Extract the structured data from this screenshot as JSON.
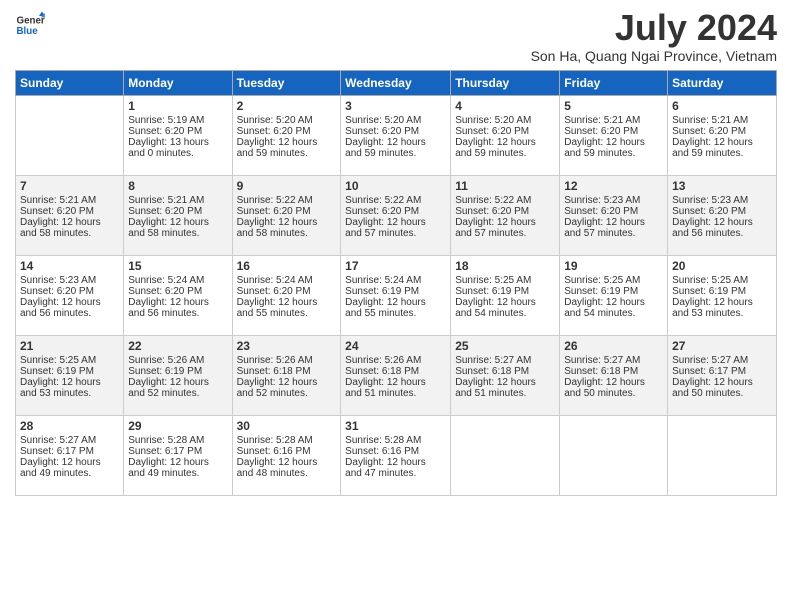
{
  "logo": {
    "line1": "General",
    "line2": "Blue"
  },
  "title": "July 2024",
  "subtitle": "Son Ha, Quang Ngai Province, Vietnam",
  "days_of_week": [
    "Sunday",
    "Monday",
    "Tuesday",
    "Wednesday",
    "Thursday",
    "Friday",
    "Saturday"
  ],
  "weeks": [
    [
      {
        "day": "",
        "info": ""
      },
      {
        "day": "1",
        "info": "Sunrise: 5:19 AM\nSunset: 6:20 PM\nDaylight: 13 hours\nand 0 minutes."
      },
      {
        "day": "2",
        "info": "Sunrise: 5:20 AM\nSunset: 6:20 PM\nDaylight: 12 hours\nand 59 minutes."
      },
      {
        "day": "3",
        "info": "Sunrise: 5:20 AM\nSunset: 6:20 PM\nDaylight: 12 hours\nand 59 minutes."
      },
      {
        "day": "4",
        "info": "Sunrise: 5:20 AM\nSunset: 6:20 PM\nDaylight: 12 hours\nand 59 minutes."
      },
      {
        "day": "5",
        "info": "Sunrise: 5:21 AM\nSunset: 6:20 PM\nDaylight: 12 hours\nand 59 minutes."
      },
      {
        "day": "6",
        "info": "Sunrise: 5:21 AM\nSunset: 6:20 PM\nDaylight: 12 hours\nand 59 minutes."
      }
    ],
    [
      {
        "day": "7",
        "info": "Sunrise: 5:21 AM\nSunset: 6:20 PM\nDaylight: 12 hours\nand 58 minutes."
      },
      {
        "day": "8",
        "info": "Sunrise: 5:21 AM\nSunset: 6:20 PM\nDaylight: 12 hours\nand 58 minutes."
      },
      {
        "day": "9",
        "info": "Sunrise: 5:22 AM\nSunset: 6:20 PM\nDaylight: 12 hours\nand 58 minutes."
      },
      {
        "day": "10",
        "info": "Sunrise: 5:22 AM\nSunset: 6:20 PM\nDaylight: 12 hours\nand 57 minutes."
      },
      {
        "day": "11",
        "info": "Sunrise: 5:22 AM\nSunset: 6:20 PM\nDaylight: 12 hours\nand 57 minutes."
      },
      {
        "day": "12",
        "info": "Sunrise: 5:23 AM\nSunset: 6:20 PM\nDaylight: 12 hours\nand 57 minutes."
      },
      {
        "day": "13",
        "info": "Sunrise: 5:23 AM\nSunset: 6:20 PM\nDaylight: 12 hours\nand 56 minutes."
      }
    ],
    [
      {
        "day": "14",
        "info": "Sunrise: 5:23 AM\nSunset: 6:20 PM\nDaylight: 12 hours\nand 56 minutes."
      },
      {
        "day": "15",
        "info": "Sunrise: 5:24 AM\nSunset: 6:20 PM\nDaylight: 12 hours\nand 56 minutes."
      },
      {
        "day": "16",
        "info": "Sunrise: 5:24 AM\nSunset: 6:20 PM\nDaylight: 12 hours\nand 55 minutes."
      },
      {
        "day": "17",
        "info": "Sunrise: 5:24 AM\nSunset: 6:19 PM\nDaylight: 12 hours\nand 55 minutes."
      },
      {
        "day": "18",
        "info": "Sunrise: 5:25 AM\nSunset: 6:19 PM\nDaylight: 12 hours\nand 54 minutes."
      },
      {
        "day": "19",
        "info": "Sunrise: 5:25 AM\nSunset: 6:19 PM\nDaylight: 12 hours\nand 54 minutes."
      },
      {
        "day": "20",
        "info": "Sunrise: 5:25 AM\nSunset: 6:19 PM\nDaylight: 12 hours\nand 53 minutes."
      }
    ],
    [
      {
        "day": "21",
        "info": "Sunrise: 5:25 AM\nSunset: 6:19 PM\nDaylight: 12 hours\nand 53 minutes."
      },
      {
        "day": "22",
        "info": "Sunrise: 5:26 AM\nSunset: 6:19 PM\nDaylight: 12 hours\nand 52 minutes."
      },
      {
        "day": "23",
        "info": "Sunrise: 5:26 AM\nSunset: 6:18 PM\nDaylight: 12 hours\nand 52 minutes."
      },
      {
        "day": "24",
        "info": "Sunrise: 5:26 AM\nSunset: 6:18 PM\nDaylight: 12 hours\nand 51 minutes."
      },
      {
        "day": "25",
        "info": "Sunrise: 5:27 AM\nSunset: 6:18 PM\nDaylight: 12 hours\nand 51 minutes."
      },
      {
        "day": "26",
        "info": "Sunrise: 5:27 AM\nSunset: 6:18 PM\nDaylight: 12 hours\nand 50 minutes."
      },
      {
        "day": "27",
        "info": "Sunrise: 5:27 AM\nSunset: 6:17 PM\nDaylight: 12 hours\nand 50 minutes."
      }
    ],
    [
      {
        "day": "28",
        "info": "Sunrise: 5:27 AM\nSunset: 6:17 PM\nDaylight: 12 hours\nand 49 minutes."
      },
      {
        "day": "29",
        "info": "Sunrise: 5:28 AM\nSunset: 6:17 PM\nDaylight: 12 hours\nand 49 minutes."
      },
      {
        "day": "30",
        "info": "Sunrise: 5:28 AM\nSunset: 6:16 PM\nDaylight: 12 hours\nand 48 minutes."
      },
      {
        "day": "31",
        "info": "Sunrise: 5:28 AM\nSunset: 6:16 PM\nDaylight: 12 hours\nand 47 minutes."
      },
      {
        "day": "",
        "info": ""
      },
      {
        "day": "",
        "info": ""
      },
      {
        "day": "",
        "info": ""
      }
    ]
  ]
}
